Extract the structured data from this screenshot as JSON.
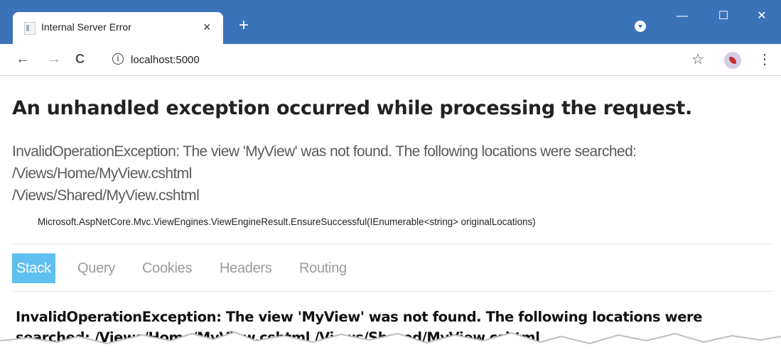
{
  "browser": {
    "tab_title": "Internal Server Error",
    "tab_close": "×",
    "new_tab": "+",
    "window_controls": {
      "minimize": "—",
      "maximize": "☐",
      "close": "✕"
    },
    "nav": {
      "back": "←",
      "forward": "→",
      "reload": "C"
    },
    "address": {
      "info": "i",
      "url": "localhost:5000"
    },
    "bookmark_star": "☆",
    "menu": "⋮"
  },
  "page": {
    "heading": "An unhandled exception occurred while processing the request.",
    "message_lines": [
      "InvalidOperationException: The view 'MyView' was not found. The following locations were searched:",
      "/Views/Home/MyView.cshtml",
      "/Views/Shared/MyView.cshtml"
    ],
    "method": "Microsoft.AspNetCore.Mvc.ViewEngines.ViewEngineResult.EnsureSuccessful(IEnumerable<string> originalLocations)",
    "tabs": [
      {
        "label": "Stack",
        "active": true
      },
      {
        "label": "Query",
        "active": false
      },
      {
        "label": "Cookies",
        "active": false
      },
      {
        "label": "Headers",
        "active": false
      },
      {
        "label": "Routing",
        "active": false
      }
    ],
    "detail": "InvalidOperationException: The view 'MyView' was not found. The following locations were searched: /Views/Home/MyView.cshtml /Views/Shared/MyView.cshtml"
  },
  "colors": {
    "titlebar": "#3b73b9",
    "active_tab": "#5fbff0",
    "muted_text": "#5a5a5a"
  }
}
